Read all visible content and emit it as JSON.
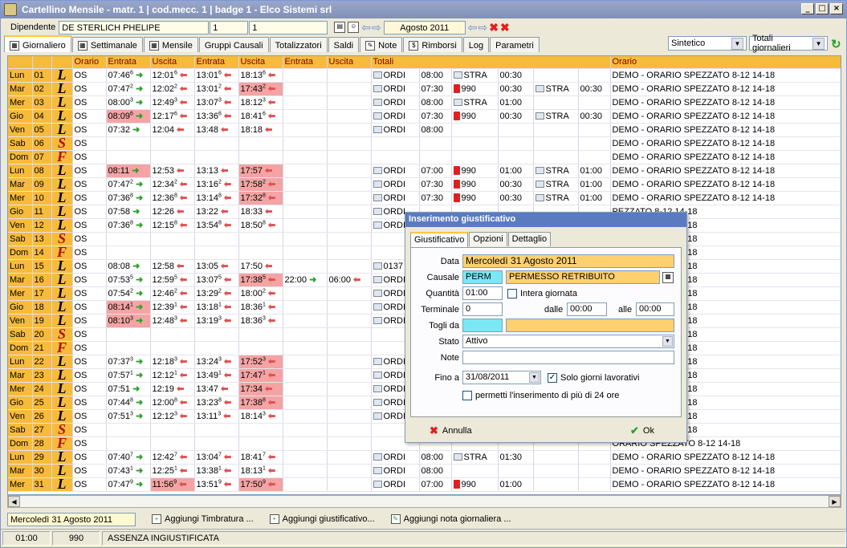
{
  "window": {
    "title": "Cartellino Mensile - matr. 1 | cod.mecc. 1 | badge 1 - Elco Sistemi srl",
    "min": "_",
    "max": "□",
    "close": "×"
  },
  "top": {
    "dipendente_label": "Dipendente",
    "dipendente": "DE STERLICH PHELIPE",
    "field1": "1",
    "field2": "1",
    "month": "Agosto 2011"
  },
  "tabs": [
    "Giornaliero",
    "Settimanale",
    "Mensile",
    "Gruppi Causali",
    "Totalizzatori",
    "Saldi",
    "Note",
    "Rimborsi",
    "Log",
    "Parametri"
  ],
  "selects": {
    "view": "Sintetico",
    "totals": "Totali giornalieri"
  },
  "headers": {
    "orario": "Orario",
    "e1": "Entrata",
    "u1": "Uscita",
    "e2": "Entrata",
    "u2": "Uscita",
    "e3": "Entrata",
    "u3": "Uscita",
    "totali": "Totali",
    "orario2": "Orario"
  },
  "rows": [
    {
      "d": "Lun",
      "n": "01",
      "l": "L",
      "o": "OS",
      "e1": "07:46",
      "s1": "6",
      "u1": "12:01",
      "s2": "6",
      "e2": "13:01",
      "s3": "6",
      "u2": "18:13",
      "s4": "6",
      "t1": "ORDI",
      "v1": "08:00",
      "t2": "STRA",
      "v2": "00:30",
      "t3": "",
      "v3": "",
      "or": "DEMO - ORARIO SPEZZATO 8-12 14-18"
    },
    {
      "d": "Mar",
      "n": "02",
      "l": "L",
      "o": "OS",
      "e1": "07:47",
      "s1": "2",
      "u1": "12:02",
      "s2": "2",
      "e2": "13:01",
      "s3": "2",
      "u2": "17:43",
      "s4": "2",
      "red4": true,
      "t1": "ORDI",
      "v1": "07:30",
      "t2": "990",
      "v2": "00:30",
      "t3": "STRA",
      "v3": "00:30",
      "or": "DEMO - ORARIO SPEZZATO 8-12 14-18"
    },
    {
      "d": "Mer",
      "n": "03",
      "l": "L",
      "o": "OS",
      "e1": "08:00",
      "s1": "3",
      "u1": "12:49",
      "s2": "3",
      "e2": "13:07",
      "s3": "3",
      "u2": "18:12",
      "s4": "3",
      "t1": "ORDI",
      "v1": "08:00",
      "t2": "STRA",
      "v2": "01:00",
      "t3": "",
      "v3": "",
      "or": "DEMO - ORARIO SPEZZATO 8-12 14-18"
    },
    {
      "d": "Gio",
      "n": "04",
      "l": "L",
      "o": "OS",
      "e1": "08:09",
      "s1": "6",
      "red1": true,
      "u1": "12:17",
      "s2": "6",
      "e2": "13:36",
      "s3": "6",
      "u2": "18:41",
      "s4": "6",
      "t1": "ORDI",
      "v1": "07:30",
      "t2": "990",
      "v2": "00:30",
      "t3": "STRA",
      "v3": "00:30",
      "or": "DEMO - ORARIO SPEZZATO 8-12 14-18"
    },
    {
      "d": "Ven",
      "n": "05",
      "l": "L",
      "o": "OS",
      "e1": "07:32",
      "s1": "",
      "u1": "12:04",
      "s2": "",
      "e2": "13:48",
      "s3": "",
      "u2": "18:18",
      "s4": "",
      "t1": "ORDI",
      "v1": "08:00",
      "t2": "",
      "v2": "",
      "t3": "",
      "v3": "",
      "or": "DEMO - ORARIO SPEZZATO 8-12 14-18"
    },
    {
      "d": "Sab",
      "n": "06",
      "l": "S",
      "o": "OS",
      "or": "DEMO - ORARIO SPEZZATO 8-12 14-18"
    },
    {
      "d": "Dom",
      "n": "07",
      "l": "F",
      "o": "OS",
      "or": "DEMO - ORARIO SPEZZATO 8-12 14-18"
    },
    {
      "d": "Lun",
      "n": "08",
      "l": "L",
      "o": "OS",
      "e1": "08:11",
      "s1": "",
      "red1": true,
      "u1": "12:53",
      "s2": "",
      "e2": "13:13",
      "s3": "",
      "u2": "17:57",
      "s4": "",
      "red4": true,
      "t1": "ORDI",
      "v1": "07:00",
      "t2": "990",
      "v2": "01:00",
      "t3": "STRA",
      "v3": "01:00",
      "or": "DEMO - ORARIO SPEZZATO 8-12 14-18"
    },
    {
      "d": "Mar",
      "n": "09",
      "l": "L",
      "o": "OS",
      "e1": "07:47",
      "s1": "2",
      "u1": "12:34",
      "s2": "2",
      "e2": "13:16",
      "s3": "2",
      "u2": "17:58",
      "s4": "2",
      "red4": true,
      "t1": "ORDI",
      "v1": "07:30",
      "t2": "990",
      "v2": "00:30",
      "t3": "STRA",
      "v3": "01:00",
      "or": "DEMO - ORARIO SPEZZATO 8-12 14-18"
    },
    {
      "d": "Mer",
      "n": "10",
      "l": "L",
      "o": "OS",
      "e1": "07:36",
      "s1": "8",
      "u1": "12:36",
      "s2": "8",
      "e2": "13:14",
      "s3": "8",
      "u2": "17:32",
      "s4": "8",
      "red4": true,
      "t1": "ORDI",
      "v1": "07:30",
      "t2": "990",
      "v2": "00:30",
      "t3": "STRA",
      "v3": "01:00",
      "or": "DEMO - ORARIO SPEZZATO 8-12 14-18"
    },
    {
      "d": "Gio",
      "n": "11",
      "l": "L",
      "o": "OS",
      "e1": "07:58",
      "s1": "",
      "u1": "12:26",
      "s2": "",
      "e2": "13:22",
      "s3": "",
      "u2": "18:33",
      "s4": "",
      "t1": "ORDI",
      "v1": "",
      "t2": "",
      "v2": "",
      "t3": "",
      "v3": "",
      "or": "PEZZATO 8-12 14-18"
    },
    {
      "d": "Ven",
      "n": "12",
      "l": "L",
      "o": "OS",
      "e1": "07:36",
      "s1": "8",
      "u1": "12:15",
      "s2": "8",
      "e2": "13:54",
      "s3": "8",
      "u2": "18:50",
      "s4": "8",
      "t1": "ORDI",
      "v1": "",
      "t2": "",
      "v2": "",
      "t3": "",
      "v3": "",
      "or": "PEZZATO 8-12 14-18"
    },
    {
      "d": "Sab",
      "n": "13",
      "l": "S",
      "o": "OS",
      "or": "PEZZATO 8-12 14-18"
    },
    {
      "d": "Dom",
      "n": "14",
      "l": "F",
      "o": "OS",
      "or": "PEZZATO 8-12 14-18"
    },
    {
      "d": "Lun",
      "n": "15",
      "l": "L",
      "o": "OS",
      "e1": "08:08",
      "s1": "",
      "u1": "12:58",
      "s2": "",
      "e2": "13:05",
      "s3": "",
      "u2": "17:50",
      "s4": "",
      "t1": "0137",
      "v1": "",
      "t2": "",
      "v2": "",
      "t3": "",
      "v3": "",
      "or": "PEZZATO 8-12 14-18"
    },
    {
      "d": "Mar",
      "n": "16",
      "l": "L",
      "o": "OS",
      "e1": "07:53",
      "s1": "5",
      "u1": "12:59",
      "s2": "5",
      "e2": "13:07",
      "s3": "5",
      "u2": "17:38",
      "s4": "5",
      "red4": true,
      "e3": "22:00",
      "u3": "06:00",
      "t1": "ORDI",
      "v1": "",
      "t2": "",
      "v2": "",
      "t3": "",
      "v3": "",
      "or": "PEZZATO 8-12 14-18"
    },
    {
      "d": "Mer",
      "n": "17",
      "l": "L",
      "o": "OS",
      "e1": "07:54",
      "s1": "2",
      "u1": "12:46",
      "s2": "2",
      "e2": "13:29",
      "s3": "2",
      "u2": "18:00",
      "s4": "2",
      "t1": "ORDI",
      "v1": "",
      "t2": "",
      "v2": "",
      "t3": "",
      "v3": "",
      "or": "PEZZATO 8-12 14-18"
    },
    {
      "d": "Gio",
      "n": "18",
      "l": "L",
      "o": "OS",
      "e1": "08:14",
      "s1": "1",
      "red1": true,
      "u1": "12:39",
      "s2": "1",
      "e2": "13:18",
      "s3": "1",
      "u2": "18:36",
      "s4": "1",
      "t1": "ORDI",
      "v1": "",
      "t2": "",
      "v2": "",
      "t3": "",
      "v3": "",
      "or": "PEZZATO 8-12 14-18"
    },
    {
      "d": "Ven",
      "n": "19",
      "l": "L",
      "o": "OS",
      "e1": "08:10",
      "s1": "3",
      "red1": true,
      "u1": "12:48",
      "s2": "3",
      "e2": "13:19",
      "s3": "3",
      "u2": "18:36",
      "s4": "3",
      "t1": "ORDI",
      "v1": "",
      "t2": "",
      "v2": "",
      "t3": "",
      "v3": "",
      "or": "PEZZATO 8-12 14-18"
    },
    {
      "d": "Sab",
      "n": "20",
      "l": "S",
      "o": "OS",
      "or": "PEZZATO 8-12 14-18"
    },
    {
      "d": "Dom",
      "n": "21",
      "l": "F",
      "o": "OS",
      "or": "PEZZATO 8-12 14-18"
    },
    {
      "d": "Lun",
      "n": "22",
      "l": "L",
      "o": "OS",
      "e1": "07:37",
      "s1": "3",
      "u1": "12:18",
      "s2": "3",
      "e2": "13:24",
      "s3": "3",
      "u2": "17:52",
      "s4": "3",
      "red4": true,
      "t1": "ORDI",
      "v1": "",
      "t2": "",
      "v2": "",
      "t3": "",
      "v3": "",
      "or": "PEZZATO 8-12 14-18"
    },
    {
      "d": "Mar",
      "n": "23",
      "l": "L",
      "o": "OS",
      "e1": "07:57",
      "s1": "1",
      "u1": "12:12",
      "s2": "1",
      "e2": "13:49",
      "s3": "1",
      "u2": "17:47",
      "s4": "1",
      "red4": true,
      "t1": "ORDI",
      "v1": "",
      "t2": "",
      "v2": "",
      "t3": "",
      "v3": "",
      "or": "PEZZATO 8-12 14-18"
    },
    {
      "d": "Mer",
      "n": "24",
      "l": "L",
      "o": "OS",
      "e1": "07:51",
      "s1": "",
      "u1": "12:19",
      "s2": "",
      "e2": "13:47",
      "s3": "",
      "u2": "17:34",
      "s4": "",
      "red4": true,
      "t1": "ORDI",
      "v1": "",
      "t2": "",
      "v2": "",
      "t3": "",
      "v3": "",
      "or": "PEZZATO 8-12 14-18"
    },
    {
      "d": "Gio",
      "n": "25",
      "l": "L",
      "o": "OS",
      "e1": "07:44",
      "s1": "8",
      "u1": "12:00",
      "s2": "8",
      "e2": "13:23",
      "s3": "8",
      "u2": "17:38",
      "s4": "8",
      "red4": true,
      "t1": "ORDI",
      "v1": "",
      "t2": "",
      "v2": "",
      "t3": "",
      "v3": "",
      "or": "PEZZATO 8-12 14-18"
    },
    {
      "d": "Ven",
      "n": "26",
      "l": "L",
      "o": "OS",
      "e1": "07:51",
      "s1": "3",
      "u1": "12:12",
      "s2": "3",
      "e2": "13:11",
      "s3": "3",
      "u2": "18:14",
      "s4": "3",
      "t1": "ORDI",
      "v1": "",
      "t2": "",
      "v2": "",
      "t3": "",
      "v3": "",
      "or": "PEZZATO 8-12 14-18"
    },
    {
      "d": "Sab",
      "n": "27",
      "l": "S",
      "o": "OS",
      "or": "PEZZATO 8-12 14-18"
    },
    {
      "d": "Dom",
      "n": "28",
      "l": "F",
      "o": "OS",
      "or": "ORARIO SPEZZATO 8-12 14-18"
    },
    {
      "d": "Lun",
      "n": "29",
      "l": "L",
      "o": "OS",
      "e1": "07:40",
      "s1": "7",
      "u1": "12:42",
      "s2": "7",
      "e2": "13:04",
      "s3": "7",
      "u2": "18:41",
      "s4": "7",
      "t1": "ORDI",
      "v1": "08:00",
      "t2": "STRA",
      "v2": "01:30",
      "t3": "",
      "v3": "",
      "or": "DEMO - ORARIO SPEZZATO 8-12 14-18"
    },
    {
      "d": "Mar",
      "n": "30",
      "l": "L",
      "o": "OS",
      "e1": "07:43",
      "s1": "1",
      "u1": "12:25",
      "s2": "1",
      "e2": "13:38",
      "s3": "1",
      "u2": "18:13",
      "s4": "1",
      "t1": "ORDI",
      "v1": "08:00",
      "t2": "",
      "v2": "",
      "t3": "",
      "v3": "",
      "or": "DEMO - ORARIO SPEZZATO 8-12 14-18"
    },
    {
      "d": "Mer",
      "n": "31",
      "l": "L",
      "o": "OS",
      "e1": "07:47",
      "s1": "9",
      "u1": "11:56",
      "s2": "9",
      "red2": true,
      "e2": "13:51",
      "s3": "9",
      "u2": "17:50",
      "s4": "9",
      "red4": true,
      "t1": "ORDI",
      "v1": "07:00",
      "t2": "990",
      "v2": "01:00",
      "t3": "",
      "v3": "",
      "or": "DEMO - ORARIO SPEZZATO 8-12 14-18"
    }
  ],
  "bottom": {
    "date": "Mercoledì 31 Agosto 2011",
    "add_timbratura": "Aggiungi Timbratura ...",
    "add_giust": "Aggiungi giustificativo...",
    "add_nota": "Aggiungi nota giornaliera ..."
  },
  "status": {
    "time": "01:00",
    "code": "990",
    "desc": "ASSENZA INGIUSTIFICATA"
  },
  "dialog": {
    "title": "Inserimento giustificativo",
    "tabs": [
      "Giustificativo",
      "Opzioni",
      "Dettaglio"
    ],
    "data_label": "Data",
    "data": "Mercoledì 31 Agosto 2011",
    "causale_label": "Causale",
    "causale_code": "PERM",
    "causale_desc": "PERMESSO RETRIBUITO",
    "quantita_label": "Quantità",
    "quantita": "01:00",
    "intera": "Intera giornata",
    "terminale_label": "Terminale",
    "terminale": "0",
    "dalle_label": "dalle",
    "dalle": "00:00",
    "alle_label": "alle",
    "alle": "00:00",
    "togli_label": "Togli da",
    "stato_label": "Stato",
    "stato": "Attivo",
    "note_label": "Note",
    "fino_label": "Fino a",
    "fino": "31/08/2011",
    "solo": "Solo giorni lavorativi",
    "permetti": "permetti l'inserimento di più di 24 ore",
    "annulla": "Annulla",
    "ok": "Ok"
  }
}
